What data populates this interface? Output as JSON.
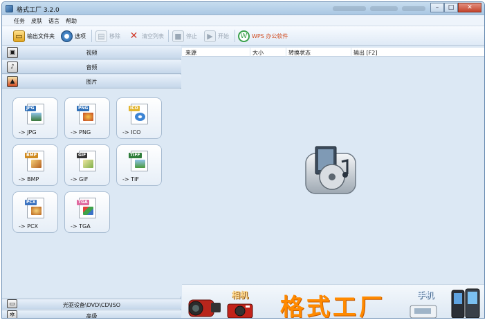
{
  "window": {
    "title": "格式工厂 3.2.0",
    "controls": {
      "minimize": "–",
      "maximize": "□",
      "close": "✕"
    }
  },
  "menu": {
    "items": [
      "任务",
      "皮肤",
      "语言",
      "帮助"
    ]
  },
  "toolbar": {
    "output_folder": "输出文件夹",
    "options": "选项",
    "remove": "移除",
    "clear_list": "清空列表",
    "stop": "停止",
    "start": "开始",
    "wps": "WPS 办公软件"
  },
  "categories": {
    "video": "视频",
    "audio": "音频",
    "image": "图片",
    "optical": "光驱设备\\DVD\\CD\\ISO",
    "advanced": "高级"
  },
  "tiles": [
    {
      "tag": "JPG",
      "label": "-> JPG"
    },
    {
      "tag": "PNG",
      "label": "-> PNG"
    },
    {
      "tag": "ICO",
      "label": "-> ICO"
    },
    {
      "tag": "BMP",
      "label": "-> BMP"
    },
    {
      "tag": "GIF",
      "label": "-> GIF"
    },
    {
      "tag": "TIFF",
      "label": "-> TIF"
    },
    {
      "tag": "PCX",
      "label": "-> PCX"
    },
    {
      "tag": "TGA",
      "label": "-> TGA"
    }
  ],
  "list": {
    "columns": [
      "来源",
      "大小",
      "转换状态",
      "输出 [F2]"
    ]
  },
  "banner": {
    "title": "格式工厂",
    "camera": "相机",
    "phone": "手机"
  },
  "colors": {
    "accent": "#ff8a00",
    "window_frame": "#6d8fb4",
    "pane_bg": "#dce8f4"
  }
}
